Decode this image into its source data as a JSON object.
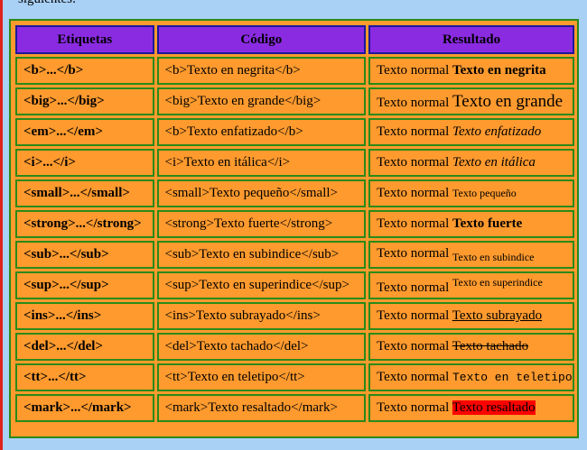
{
  "intro_text": "siguientes:",
  "table": {
    "headers": [
      "Etiquetas",
      "Código",
      "Resultado"
    ],
    "normal_prefix": "Texto normal",
    "rows": [
      {
        "tag": "<b>...</b>",
        "code": "<b>Texto en negrita</b>",
        "result": "Texto en negrita",
        "style": "bold"
      },
      {
        "tag": "<big>...</big>",
        "code": "<big>Texto en grande</big>",
        "result": "Texto en grande",
        "style": "big"
      },
      {
        "tag": "<em>...</em>",
        "code": "<b>Texto enfatizado</b>",
        "result": "Texto enfatizado",
        "style": "italic"
      },
      {
        "tag": "<i>...</i>",
        "code": "<i>Texto en itálica</i>",
        "result": "Texto en itálica",
        "style": "italic"
      },
      {
        "tag": "<small>...</small>",
        "code": "<small>Texto pequeño</small>",
        "result": "Texto pequeño",
        "style": "small"
      },
      {
        "tag": "<strong>...</strong>",
        "code": "<strong>Texto fuerte</strong>",
        "result": "Texto fuerte",
        "style": "bold"
      },
      {
        "tag": "<sub>...</sub>",
        "code": "<sub>Texto en subindice</sub>",
        "result": "Texto en subindice",
        "style": "sub"
      },
      {
        "tag": "<sup>...</sup>",
        "code": "<sup>Texto en superindice</sup>",
        "result": "Texto en superindice",
        "style": "sup"
      },
      {
        "tag": "<ins>...</ins>",
        "code": "<ins>Texto subrayado</ins>",
        "result": "Texto subrayado",
        "style": "underline"
      },
      {
        "tag": "<del>...</del>",
        "code": "<del>Texto tachado</del>",
        "result": "Texto tachado",
        "style": "strike"
      },
      {
        "tag": "<tt>...</tt>",
        "code": "<tt>Texto en teletipo</tt>",
        "result": "Texto en teletipo",
        "style": "mono"
      },
      {
        "tag": "<mark>...</mark>",
        "code": "<mark>Texto resaltado</mark>",
        "result": "Texto resaltado",
        "style": "mark"
      }
    ]
  },
  "colors": {
    "page_background": "#a9d0f5",
    "table_background": "#ff9a2e",
    "header_background": "#8a2be2",
    "header_border": "#1a1a9a",
    "cell_border": "#2a8a18",
    "mark_highlight": "#ff0000"
  }
}
